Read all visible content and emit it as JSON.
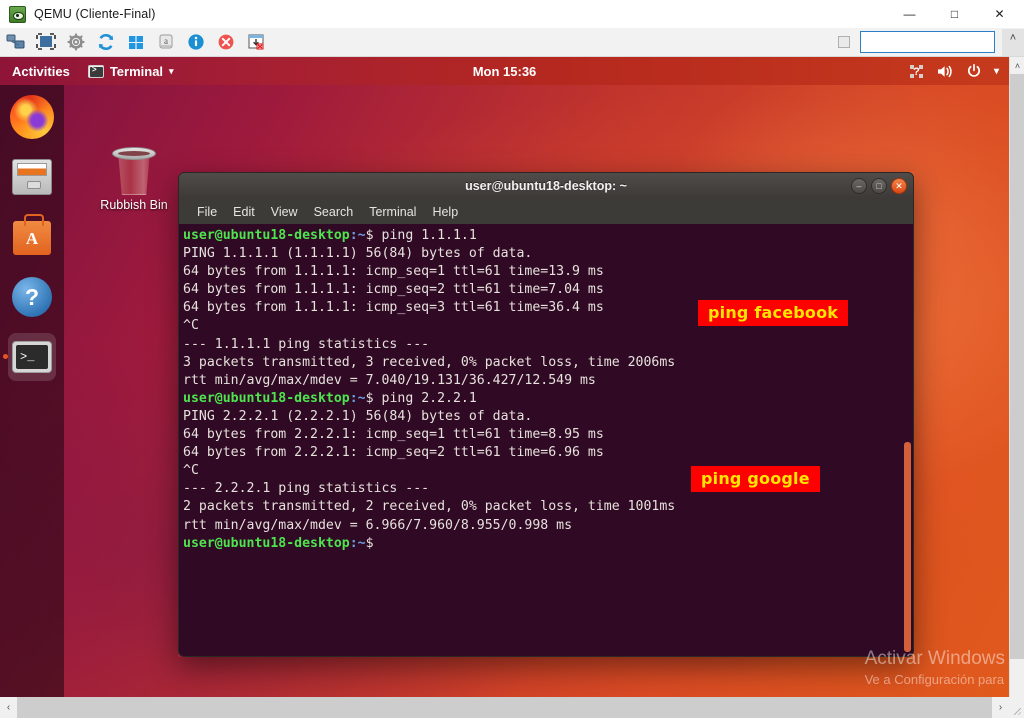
{
  "host_window": {
    "title": "QEMU (Cliente-Final)",
    "app_icon": "qemu-icon",
    "controls": {
      "minimize": "—",
      "maximize": "□",
      "close": "✕"
    },
    "toolbar": {
      "buttons": [
        {
          "name": "network-icon",
          "title": "Network"
        },
        {
          "name": "fullscreen-icon",
          "title": "Fullscreen"
        },
        {
          "name": "settings-gear-icon",
          "title": "Settings"
        },
        {
          "name": "refresh-icon",
          "title": "Refresh"
        },
        {
          "name": "windows-logo-icon",
          "title": "Send Windows key"
        },
        {
          "name": "keyboard-key-icon",
          "title": "Send key"
        },
        {
          "name": "info-icon",
          "title": "Info"
        },
        {
          "name": "disconnect-icon",
          "title": "Disconnect"
        },
        {
          "name": "capture-window-icon",
          "title": "Capture"
        }
      ],
      "address_value": "",
      "address_placeholder": "",
      "chevron_up": "˄"
    }
  },
  "guest": {
    "topbar": {
      "activities": "Activities",
      "app_menu": {
        "label": "Terminal",
        "icon": "terminal-icon",
        "caret": "▾"
      },
      "clock": "Mon 15:36",
      "tray": {
        "keyboard_icon": "keyboard-indicator-icon",
        "volume_icon": "volume-icon",
        "power_icon": "power-icon",
        "caret": "▾"
      }
    },
    "dock": [
      {
        "name": "dock-item-firefox",
        "label": "Firefox",
        "icon": "firefox-icon",
        "active": false
      },
      {
        "name": "dock-item-files",
        "label": "Files",
        "icon": "files-icon",
        "active": false
      },
      {
        "name": "dock-item-software",
        "label": "Ubuntu Software",
        "icon": "ubuntu-software-icon",
        "active": false
      },
      {
        "name": "dock-item-help",
        "label": "Help",
        "icon": "help-icon",
        "active": false
      },
      {
        "name": "dock-item-terminal",
        "label": "Terminal",
        "icon": "terminal-icon",
        "active": true
      }
    ],
    "desktop_icons": [
      {
        "name": "rubbish-bin",
        "label": "Rubbish Bin",
        "icon": "trash-icon"
      }
    ],
    "watermark": {
      "line1": "Activar Windows",
      "line2": "Ve a Configuración para"
    }
  },
  "terminal": {
    "title": "user@ubuntu18-desktop: ~",
    "controls": {
      "minimize": "—",
      "maximize": "□",
      "close": "✕"
    },
    "menus": [
      "File",
      "Edit",
      "View",
      "Search",
      "Terminal",
      "Help"
    ],
    "prompt": {
      "user_host": "user@ubuntu18-desktop",
      "path": ":~",
      "symbol": "$"
    },
    "lines": [
      {
        "type": "prompt",
        "command": " ping 1.1.1.1"
      },
      {
        "type": "out",
        "text": "PING 1.1.1.1 (1.1.1.1) 56(84) bytes of data."
      },
      {
        "type": "out",
        "text": "64 bytes from 1.1.1.1: icmp_seq=1 ttl=61 time=13.9 ms"
      },
      {
        "type": "out",
        "text": "64 bytes from 1.1.1.1: icmp_seq=2 ttl=61 time=7.04 ms"
      },
      {
        "type": "out",
        "text": "64 bytes from 1.1.1.1: icmp_seq=3 ttl=61 time=36.4 ms"
      },
      {
        "type": "out",
        "text": "^C"
      },
      {
        "type": "out",
        "text": "--- 1.1.1.1 ping statistics ---"
      },
      {
        "type": "out",
        "text": "3 packets transmitted, 3 received, 0% packet loss, time 2006ms"
      },
      {
        "type": "out",
        "text": "rtt min/avg/max/mdev = 7.040/19.131/36.427/12.549 ms"
      },
      {
        "type": "prompt",
        "command": " ping 2.2.2.1"
      },
      {
        "type": "out",
        "text": "PING 2.2.2.1 (2.2.2.1) 56(84) bytes of data."
      },
      {
        "type": "out",
        "text": "64 bytes from 2.2.2.1: icmp_seq=1 ttl=61 time=8.95 ms"
      },
      {
        "type": "out",
        "text": "64 bytes from 2.2.2.1: icmp_seq=2 ttl=61 time=6.96 ms"
      },
      {
        "type": "out",
        "text": "^C"
      },
      {
        "type": "out",
        "text": "--- 2.2.2.1 ping statistics ---"
      },
      {
        "type": "out",
        "text": "2 packets transmitted, 2 received, 0% packet loss, time 1001ms"
      },
      {
        "type": "out",
        "text": "rtt min/avg/max/mdev = 6.966/7.960/8.955/0.998 ms"
      },
      {
        "type": "prompt",
        "command": ""
      }
    ]
  },
  "annotations": [
    {
      "name": "annotation-ping-facebook",
      "text": "ping facebook"
    },
    {
      "name": "annotation-ping-google",
      "text": "ping google"
    }
  ],
  "scrollbars": {
    "vertical": {
      "up": "˄",
      "down": "˅"
    },
    "horizontal": {
      "left": "‹",
      "right": "›"
    }
  },
  "colors": {
    "ubuntu_accent": "#e95420",
    "terminal_bg": "#300a24",
    "annotation_bg": "#ff0000",
    "annotation_fg": "#ffe600",
    "prompt_green": "#4ee44e",
    "prompt_blue": "#6a9fe0"
  }
}
